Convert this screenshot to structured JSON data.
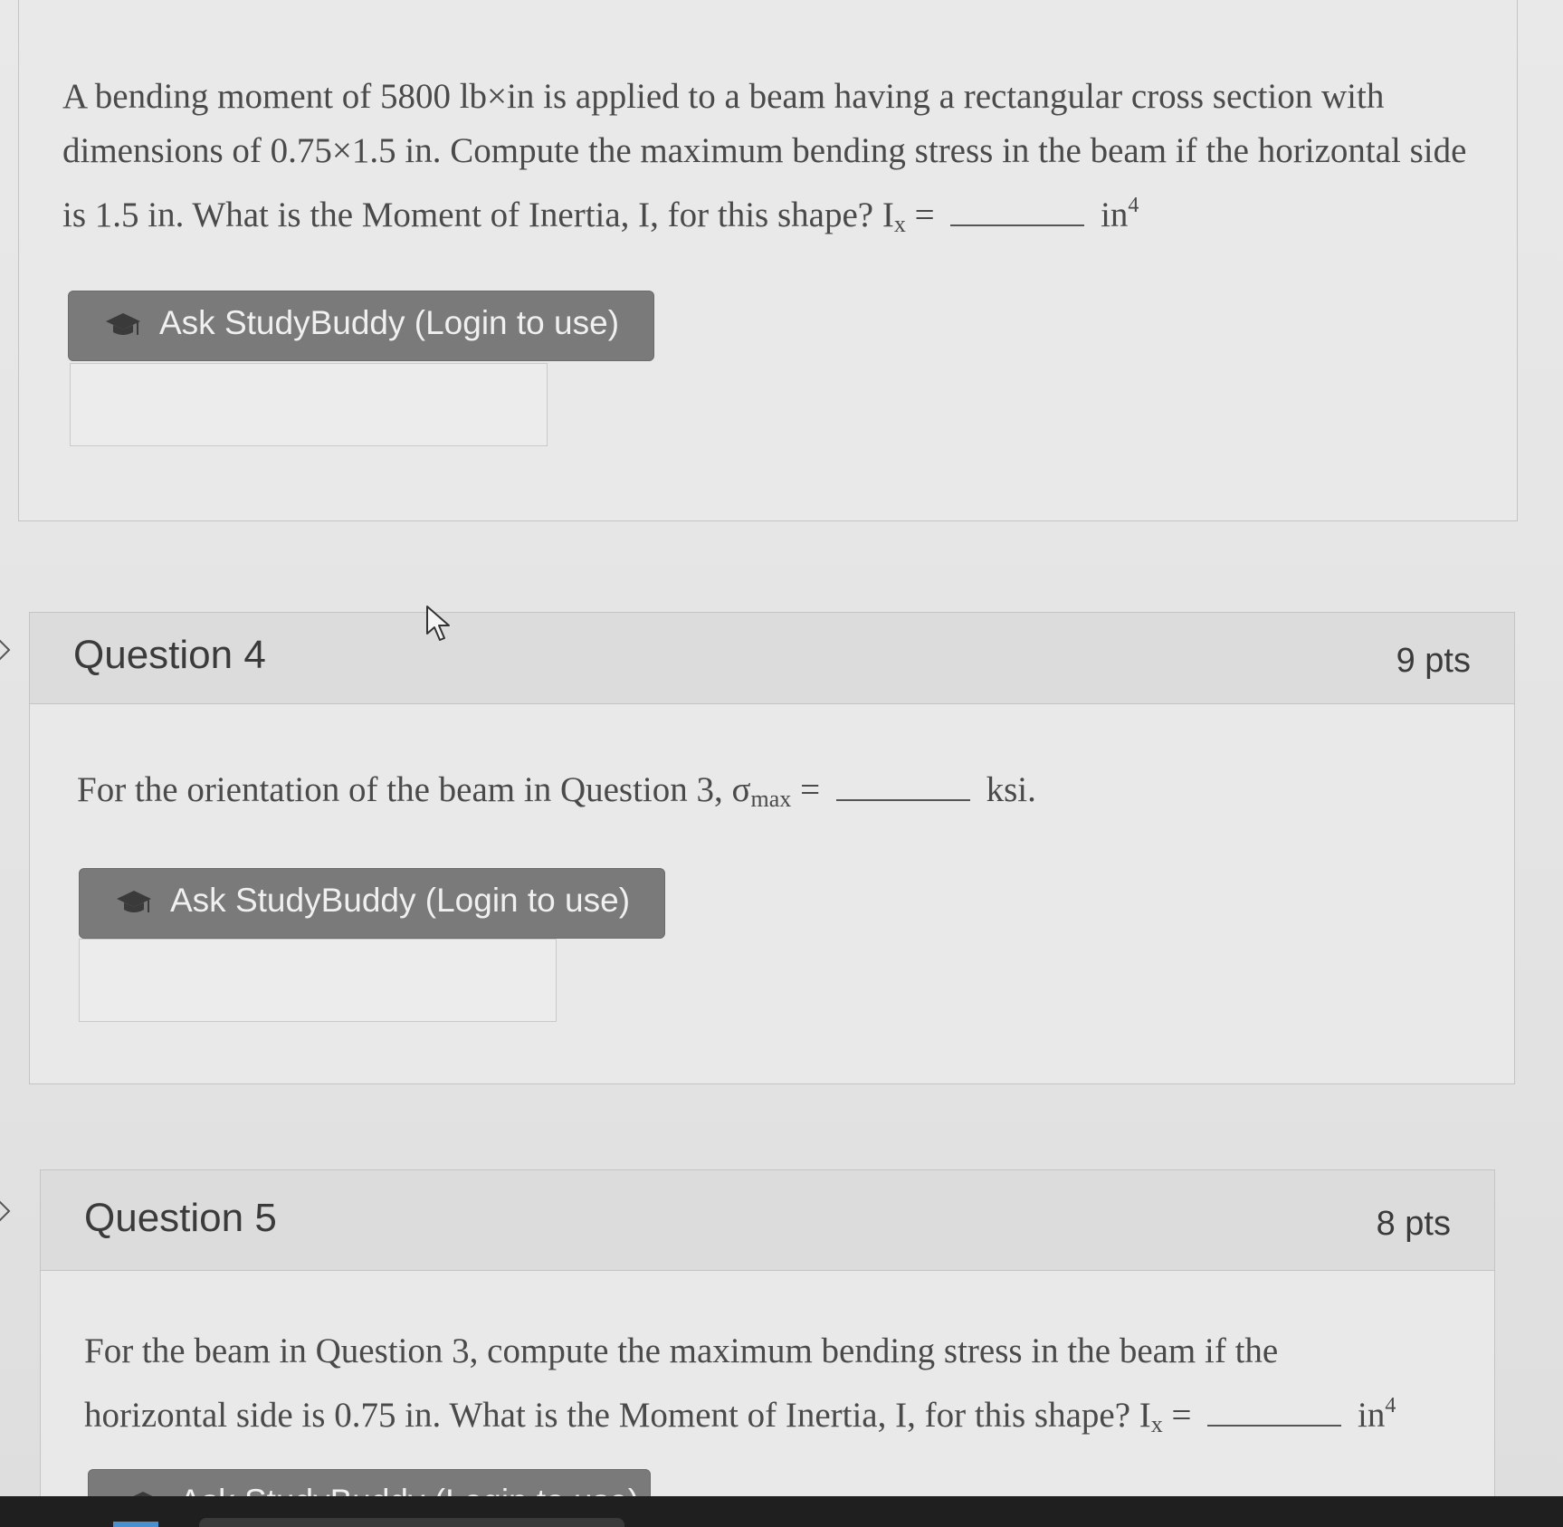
{
  "question3": {
    "text_part1": "A bending moment of 5800 lb×in is applied to a beam having a rectangular cross section with dimensions of 0.75×1.5 in. Compute the maximum bending stress in the beam if the horizontal side is 1.5 in. What is the Moment of Inertia, I, for this shape? I",
    "subscript": "x",
    "equals": "=",
    "unit": "in",
    "unit_exponent": "4",
    "ask_button": "Ask StudyBuddy (Login to use)"
  },
  "question4": {
    "title": "Question 4",
    "points": "9 pts",
    "text_part1": "For the orientation of the beam in Question 3, σ",
    "subscript": "max",
    "equals": "=",
    "unit": "ksi.",
    "ask_button": "Ask StudyBuddy (Login to use)"
  },
  "question5": {
    "title": "Question 5",
    "points": "8 pts",
    "text_part1": "For the beam in Question 3, compute the maximum bending stress in the beam if the horizontal side is 0.75 in. What is the Moment of Inertia, I, for this shape? I",
    "subscript": "x",
    "equals": "=",
    "unit": "in",
    "unit_exponent": "4",
    "ask_button": "Ask StudyBuddy (Login to use)"
  }
}
